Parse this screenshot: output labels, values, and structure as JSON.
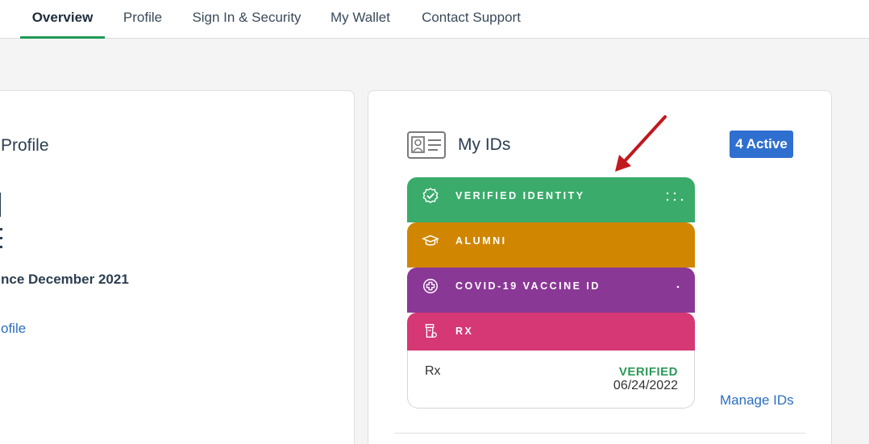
{
  "nav": {
    "tabs": [
      {
        "label": "Overview",
        "active": true
      },
      {
        "label": "Profile"
      },
      {
        "label": "Sign In & Security"
      },
      {
        "label": "My Wallet"
      },
      {
        "label": "Contact Support"
      }
    ]
  },
  "left_card": {
    "title": "Profile",
    "since_text": "nce December 2021",
    "link_text": "ofile"
  },
  "ids_card": {
    "title": "My IDs",
    "active_badge": "4 Active",
    "ids": [
      {
        "label": "VERIFIED IDENTITY",
        "color": "#3aab6b",
        "icon": "verified-badge-icon"
      },
      {
        "label": "ALUMNI",
        "color": "#d08600",
        "icon": "graduation-cap-icon"
      },
      {
        "label": "COVID-19 VACCINE ID",
        "color": "#8a3896",
        "icon": "medical-cross-icon"
      },
      {
        "label": "RX",
        "color": "#d63775",
        "icon": "prescription-bottle-icon"
      }
    ],
    "rx_detail": {
      "name": "Rx",
      "status": "VERIFIED",
      "date": "06/24/2022"
    },
    "manage_link": "Manage IDs"
  },
  "colors": {
    "accent_green": "#1f9a56",
    "link_blue": "#2a6fbe",
    "badge_blue": "#2f6fd0",
    "annotation_arrow": "#c0191f"
  }
}
